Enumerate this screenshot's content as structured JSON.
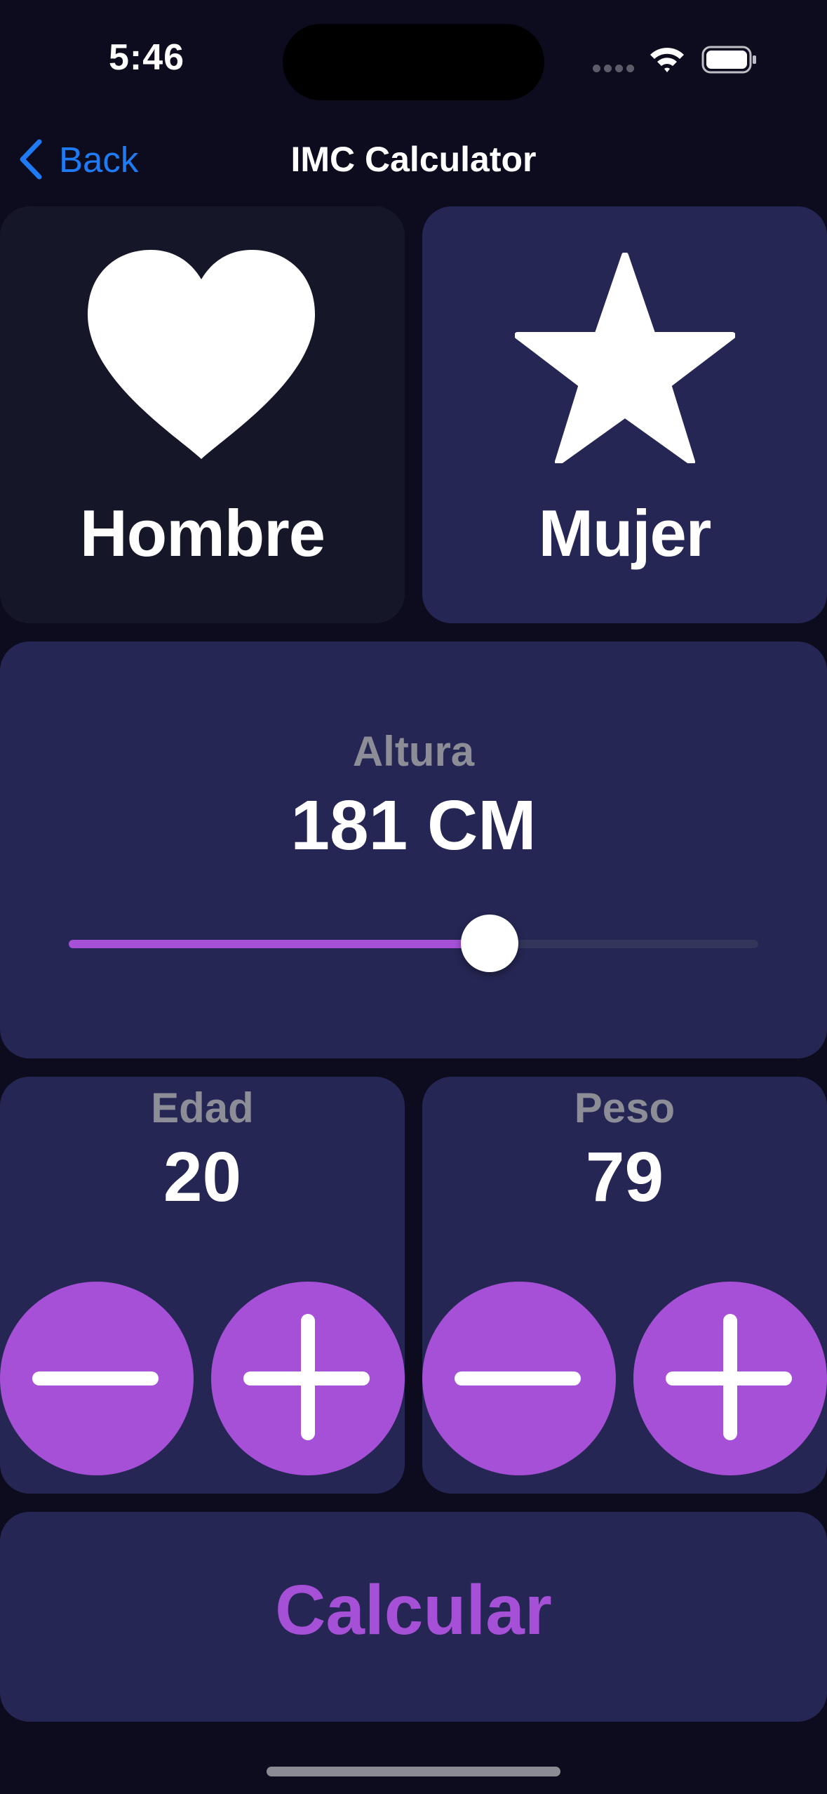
{
  "status_bar": {
    "time": "5:46"
  },
  "nav": {
    "back_label": "Back",
    "title": "IMC Calculator"
  },
  "gender": {
    "male": {
      "label": "Hombre",
      "icon": "heart-icon",
      "selected": true
    },
    "female": {
      "label": "Mujer",
      "icon": "star-icon",
      "selected": false
    }
  },
  "height": {
    "label": "Altura",
    "value_text": "181 CM",
    "slider_fraction": 0.61
  },
  "age": {
    "label": "Edad",
    "value": "20"
  },
  "weight": {
    "label": "Peso",
    "value": "79"
  },
  "calculate": {
    "label": "Calcular"
  },
  "colors": {
    "background": "#0d0c1f",
    "card": "#252653",
    "card_selected": "#151729",
    "accent": "#a550d6",
    "link": "#1f7bf4",
    "muted_text": "#8d8d97"
  }
}
